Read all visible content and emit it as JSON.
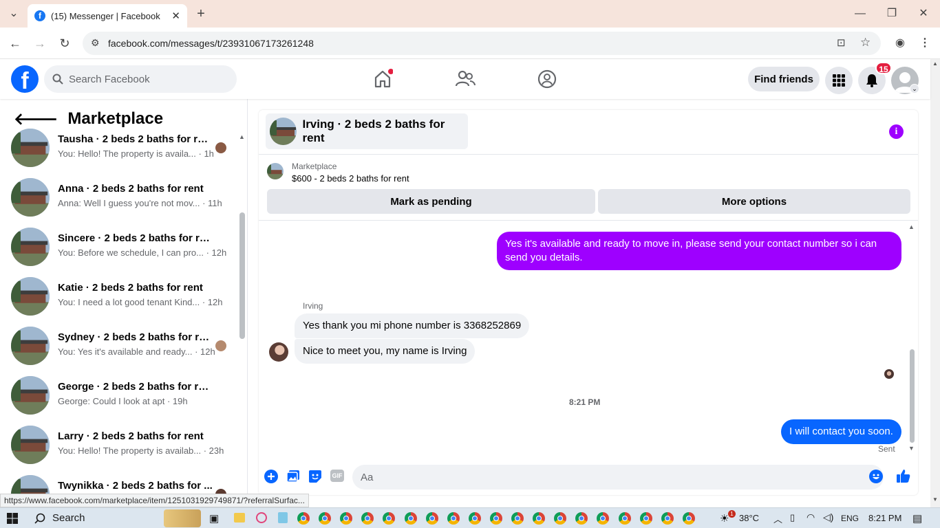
{
  "browser": {
    "tab_title": "(15) Messenger | Facebook",
    "url": "facebook.com/messages/t/23931067173261248",
    "status_url": "https://www.facebook.com/marketplace/item/1251031929749871/?referralSurfac..."
  },
  "fb_header": {
    "search_placeholder": "Search Facebook",
    "find_friends": "Find friends",
    "notification_count": "15"
  },
  "left_panel": {
    "title": "Marketplace",
    "conversations": [
      {
        "name": "Tausha · 2 beds 2 baths for rent",
        "preview": "You: Hello! The property is availa... · 1h"
      },
      {
        "name": "Anna · 2 beds 2 baths for rent",
        "preview": "Anna: Well I guess you're not mov... · 11h"
      },
      {
        "name": "Sincere · 2 beds 2 baths for rent",
        "preview": "You: Before we schedule, I can pro... · 12h"
      },
      {
        "name": "Katie · 2 beds 2 baths for rent",
        "preview": "You: I need a lot good tenant Kind... · 12h"
      },
      {
        "name": "Sydney · 2 beds 2 baths for rent",
        "preview": "You: Yes it's available and ready... · 12h"
      },
      {
        "name": "George · 2 beds 2 baths for rent",
        "preview": "George: Could I look at apt · 19h"
      },
      {
        "name": "Larry · 2 beds 2 baths for rent",
        "preview": "You: Hello! The property is availab... · 23h"
      },
      {
        "name": "Twynikka · 2 beds 2 baths for ...",
        "preview": ""
      }
    ]
  },
  "chat": {
    "title": "Irving · 2 beds 2 baths for rent",
    "marketplace_label": "Marketplace",
    "listing": "$600 - 2 beds 2 baths for rent",
    "mark_pending": "Mark as pending",
    "more_options": "More options",
    "messages": [
      {
        "text": "Yes it's available and ready to move in, please send your contact number so i can send you details."
      },
      {
        "sender": "Irving"
      },
      {
        "text": "Yes thank you mi phone number is 3368252869"
      },
      {
        "text": "Nice to meet you, my name is Irving"
      },
      {
        "text": "I will contact you soon."
      }
    ],
    "timestamp": "8:21 PM",
    "sent_label": "Sent",
    "input_placeholder": "Aa",
    "gif_label": "GIF"
  },
  "taskbar": {
    "search": "Search",
    "temperature": "38°C",
    "language": "ENG",
    "time": "8:21 PM",
    "weather_badge": "1"
  }
}
